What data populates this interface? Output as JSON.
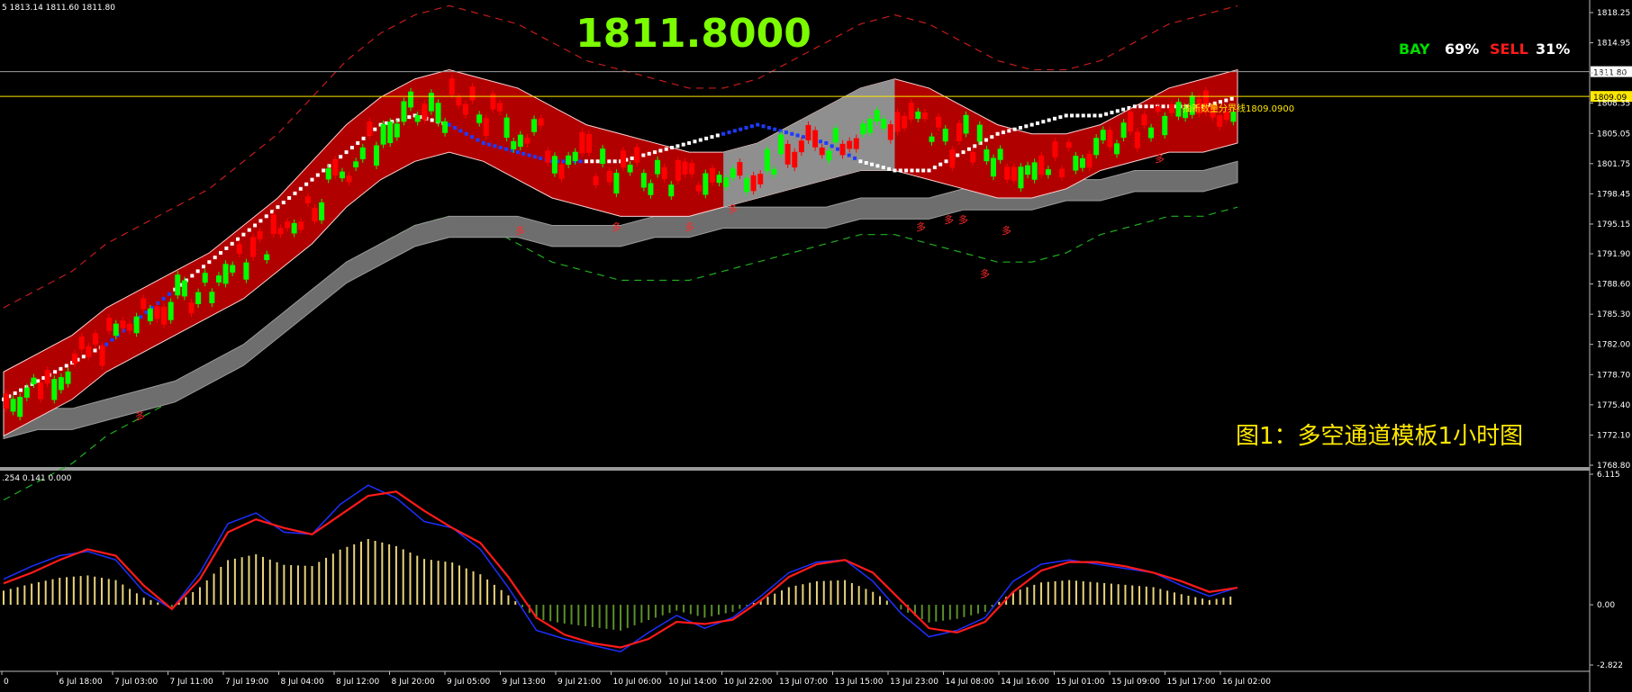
{
  "header": {
    "ohlc_text": "5 1813.14 1811.60 1811.80"
  },
  "price_display": {
    "value": "1811.8000"
  },
  "signals": {
    "buy_label": "BAY",
    "buy_pct": "69%",
    "sell_label": "SELL",
    "sell_pct": "31%"
  },
  "caption": "图1：多空通道模板1小时图",
  "support_line": {
    "label": "抽新数量分界线1809.0900",
    "value": "1809.09"
  },
  "current_price_tag": "1811.80",
  "signal_marker": "多",
  "indicator": {
    "header": ".254 0.141 0.000"
  },
  "colors": {
    "bull": "#00ff00",
    "bear": "#ff0000",
    "magenta": "#ff00ff",
    "channel_fill": "#b00000",
    "gray_band": "#6e6e6e",
    "macd_fast": "#1f2fff",
    "macd_slow": "#ff1a1a",
    "hist_pos": "#e8d27a",
    "hist_neg": "#5a8f2a"
  },
  "chart_data": [
    {
      "type": "candlestick",
      "title": "",
      "y_ticks": [
        "1818.25",
        "1814.95",
        "1811.65",
        "1808.35",
        "1805.05",
        "1801.75",
        "1798.45",
        "1795.15",
        "1791.90",
        "1788.60",
        "1785.30",
        "1782.00",
        "1778.70",
        "1775.40",
        "1772.10",
        "1768.80"
      ],
      "ylim": [
        1768.8,
        1818.25
      ],
      "x_ticks": [
        "0",
        "6 Jul 18:00",
        "7 Jul 03:00",
        "7 Jul 11:00",
        "7 Jul 19:00",
        "8 Jul 04:00",
        "8 Jul 12:00",
        "8 Jul 20:00",
        "9 Jul 05:00",
        "9 Jul 13:00",
        "9 Jul 21:00",
        "10 Jul 06:00",
        "10 Jul 14:00",
        "10 Jul 22:00",
        "13 Jul 07:00",
        "13 Jul 15:00",
        "13 Jul 23:00",
        "14 Jul 08:00",
        "14 Jul 16:00",
        "15 Jul 01:00",
        "15 Jul 09:00",
        "15 Jul 17:00",
        "16 Jul 02:00"
      ],
      "series": [
        {
          "values": [
            1779,
            1781,
            1783,
            1786,
            1788,
            1790,
            1792,
            1795,
            1798,
            1802,
            1806,
            1809,
            1811,
            1812,
            1811,
            1810,
            1808,
            1806,
            1805,
            1804,
            1803,
            1803,
            1804,
            1806,
            1808,
            1810,
            1811,
            1810,
            1808,
            1806,
            1805,
            1805,
            1806,
            1808,
            1810,
            1811,
            1812
          ]
        },
        {
          "values": [
            1772,
            1774,
            1776,
            1779,
            1781,
            1783,
            1785,
            1787,
            1790,
            1793,
            1797,
            1800,
            1802,
            1803,
            1802,
            1800,
            1798,
            1797,
            1796,
            1796,
            1796,
            1797,
            1798,
            1799,
            1800,
            1801,
            1801,
            1800,
            1799,
            1798,
            1798,
            1799,
            1801,
            1802,
            1803,
            1803,
            1804
          ]
        },
        {
          "values": [
            1774,
            1775,
            1775,
            1776,
            1777,
            1778,
            1780,
            1782,
            1785,
            1788,
            1791,
            1793,
            1795,
            1796,
            1796,
            1796,
            1795,
            1795,
            1795,
            1796,
            1796,
            1797,
            1797,
            1797,
            1797,
            1798,
            1798,
            1798,
            1799,
            1799,
            1799,
            1800,
            1800,
            1801,
            1801,
            1801,
            1802
          ]
        },
        {
          "values": [
            1776,
            1778,
            1780,
            1782,
            1785,
            1788,
            1791,
            1794,
            1797,
            1800,
            1803,
            1806,
            1807,
            1806,
            1804,
            1803,
            1802,
            1802,
            1802,
            1803,
            1804,
            1805,
            1806,
            1805,
            1804,
            1802,
            1801,
            1801,
            1803,
            1805,
            1806,
            1807,
            1807,
            1808,
            1808,
            1808,
            1809
          ]
        }
      ]
    },
    {
      "type": "line",
      "title": "",
      "y_ticks": [
        "6.115",
        "0.00",
        "-2.822"
      ],
      "ylim": [
        -2.822,
        6.115
      ],
      "series": [
        {
          "values": [
            1.2,
            1.8,
            2.3,
            2.5,
            2.1,
            0.6,
            -0.2,
            1.5,
            3.8,
            4.3,
            3.4,
            3.3,
            4.7,
            5.6,
            5.0,
            3.9,
            3.6,
            2.6,
            0.8,
            -1.2,
            -1.6,
            -1.9,
            -2.2,
            -1.3,
            -0.5,
            -1.1,
            -0.6,
            0.4,
            1.5,
            2.0,
            2.1,
            1.1,
            -0.4,
            -1.5,
            -1.2,
            -0.6,
            1.1,
            1.9,
            2.1,
            1.9,
            1.7,
            1.5,
            0.9,
            0.4,
            0.8
          ]
        },
        {
          "values": [
            1.0,
            1.5,
            2.1,
            2.6,
            2.3,
            0.9,
            -0.2,
            1.2,
            3.4,
            4.0,
            3.6,
            3.3,
            4.2,
            5.1,
            5.3,
            4.4,
            3.6,
            2.9,
            1.3,
            -0.6,
            -1.4,
            -1.8,
            -2.0,
            -1.6,
            -0.8,
            -0.9,
            -0.7,
            0.2,
            1.3,
            1.9,
            2.1,
            1.5,
            0.2,
            -1.1,
            -1.3,
            -0.8,
            0.6,
            1.6,
            2.0,
            2.0,
            1.8,
            1.5,
            1.1,
            0.6,
            0.8
          ]
        }
      ]
    }
  ]
}
